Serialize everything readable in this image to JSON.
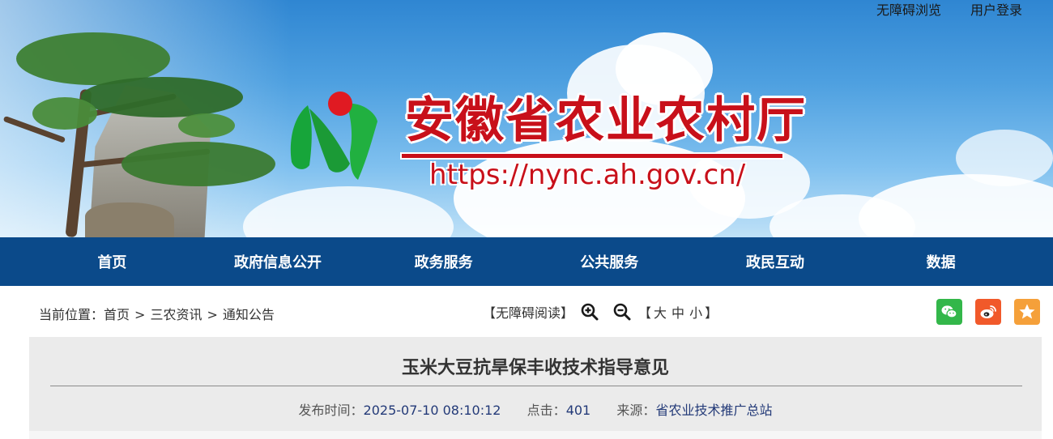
{
  "header": {
    "site_title": "安徽省农业农村厅",
    "site_url": "https://nync.ah.gov.cn/",
    "top_links": [
      "无障碍浏览",
      "用户登录"
    ],
    "brand_red": "#c8101a"
  },
  "nav": {
    "bg_color": "#0b4a8a",
    "items": [
      "首页",
      "政府信息公开",
      "政务服务",
      "公共服务",
      "政民互动",
      "数据"
    ]
  },
  "breadcrumb": {
    "prefix": "当前位置：",
    "items": [
      "首页",
      "三农资讯",
      "通知公告"
    ],
    "separator": ">"
  },
  "tools": {
    "accessible_reading": "【无障碍阅读】",
    "zoom_in_icon": "zoom-in-icon",
    "zoom_out_icon": "zoom-out-icon",
    "bracket_open": "【",
    "size_large": "大",
    "size_medium": "中",
    "size_small": "小",
    "bracket_close": "】"
  },
  "share": {
    "icons": [
      "wechat-icon",
      "weibo-icon",
      "favorite-icon"
    ],
    "colors": [
      "#33b74a",
      "#f1592a",
      "#f5a03a"
    ]
  },
  "article": {
    "title": "玉米大豆抗旱保丰收技术指导意见",
    "publish_label": "发布时间：",
    "publish_time": "2025-07-10 08:10:12",
    "clicks_label": "点击：",
    "clicks": "401",
    "source_label": "来源：",
    "source": "省农业技术推广总站"
  }
}
